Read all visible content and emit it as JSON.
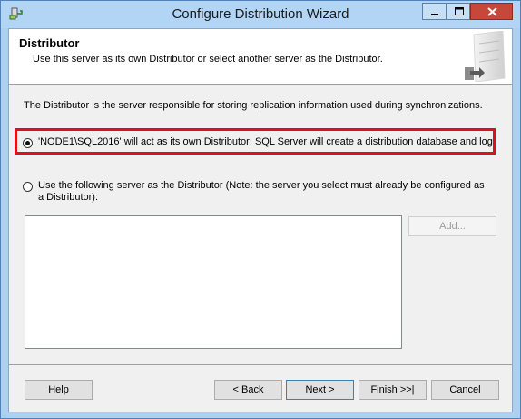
{
  "window": {
    "title": "Configure Distribution Wizard"
  },
  "header": {
    "title": "Distributor",
    "subtitle": "Use this server as its own Distributor or select another server as the Distributor."
  },
  "body": {
    "description": "The Distributor is the server responsible for storing replication information used during synchronizations.",
    "option_own": "'NODE1\\SQL2016' will act as its own Distributor; SQL Server will create a distribution database and log",
    "option_other": "Use the following server as the Distributor (Note: the server you select must already be configured as a Distributor):",
    "selected_option": "own",
    "add_label": "Add..."
  },
  "footer": {
    "help": "Help",
    "back": "< Back",
    "next": "Next >",
    "finish": "Finish >>|",
    "cancel": "Cancel"
  },
  "colors": {
    "highlight_box": "#e0101a",
    "titlebar": "#b3d5f5",
    "close_button": "#c7473b"
  }
}
